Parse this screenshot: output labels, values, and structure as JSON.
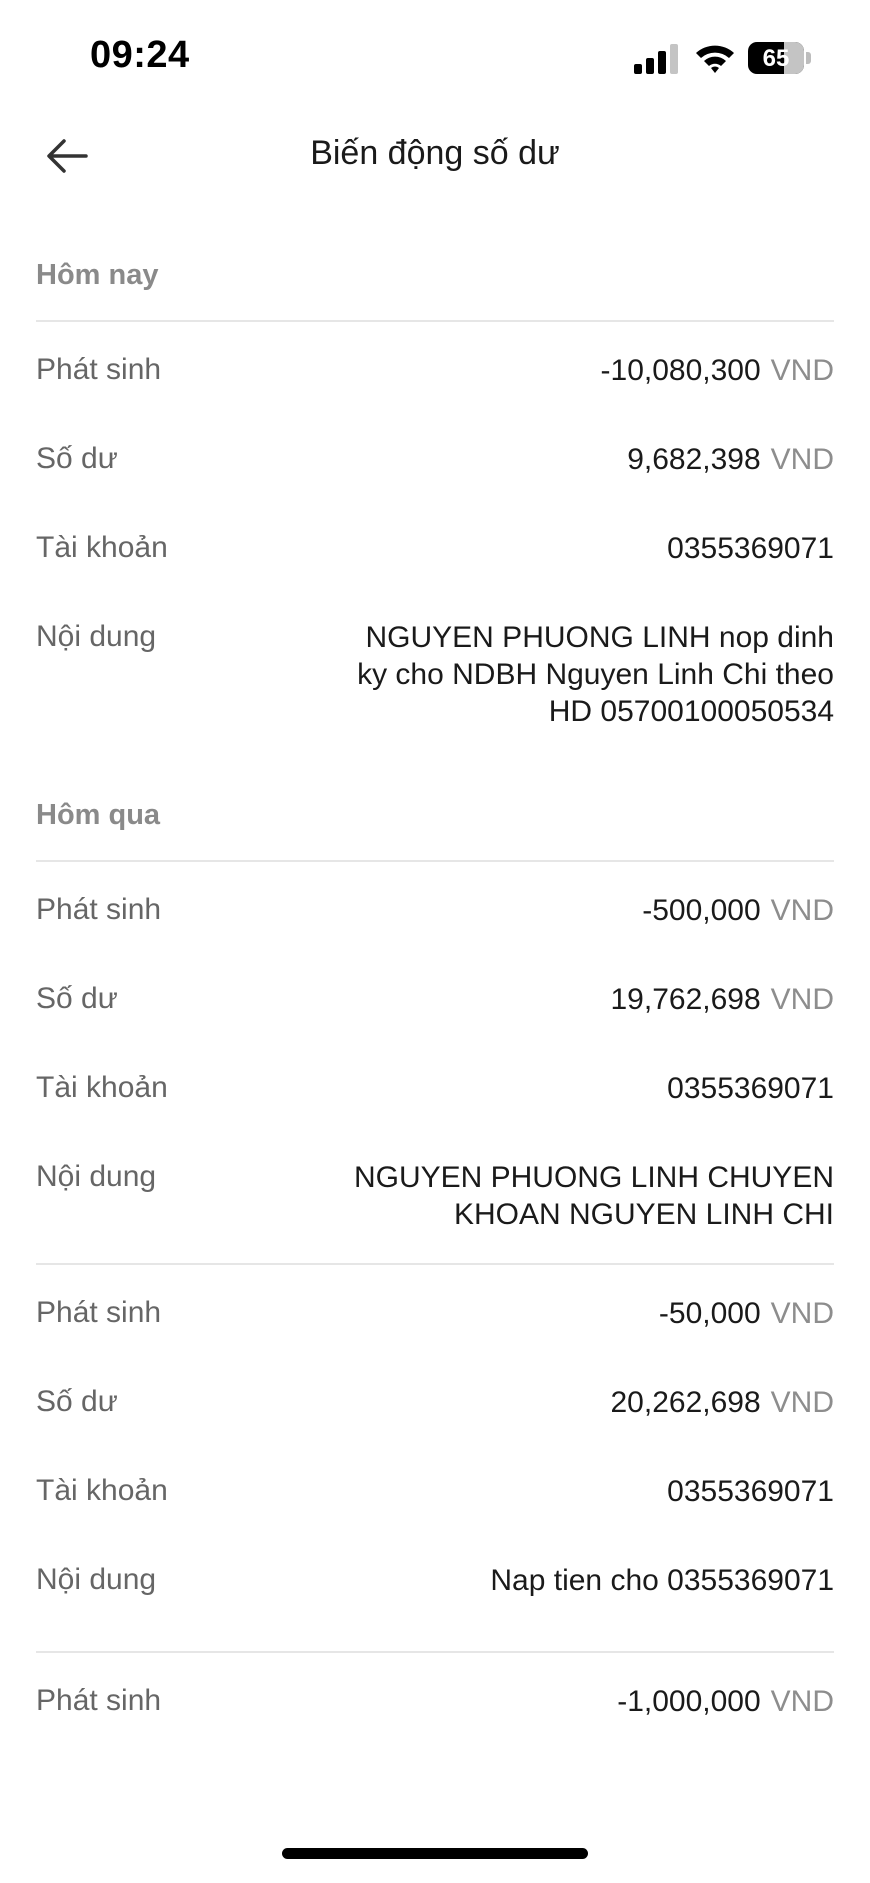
{
  "status_bar": {
    "time": "09:24",
    "battery": "65"
  },
  "header": {
    "title": "Biến động số dư"
  },
  "labels": {
    "amount": "Phát sinh",
    "balance": "Số dư",
    "account": "Tài khoản",
    "description": "Nội dung",
    "currency": "VND"
  },
  "sections": [
    {
      "heading": "Hôm nay",
      "transactions": [
        {
          "amount": "-10,080,300",
          "balance": "9,682,398",
          "account": "0355369071",
          "description": "NGUYEN PHUONG LINH nop dinh ky cho NDBH Nguyen Linh Chi theo HD 05700100050534"
        }
      ]
    },
    {
      "heading": "Hôm qua",
      "transactions": [
        {
          "amount": "-500,000",
          "balance": "19,762,698",
          "account": "0355369071",
          "description": "NGUYEN PHUONG LINH CHUYEN KHOAN NGUYEN LINH CHI"
        },
        {
          "amount": "-50,000",
          "balance": "20,262,698",
          "account": "0355369071",
          "description": "Nap tien cho 0355369071"
        },
        {
          "amount": "-1,000,000"
        }
      ]
    }
  ]
}
